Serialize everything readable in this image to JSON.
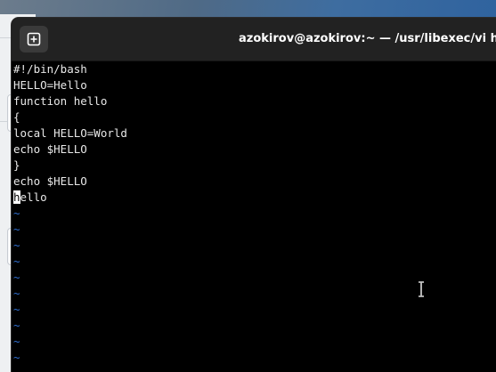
{
  "window": {
    "title": "azokirov@azokirov:~ — /usr/libexec/vi hello"
  },
  "editor": {
    "lines": [
      "#!/bin/bash",
      "HELLO=Hello",
      "function hello",
      "{",
      "local HELLO=World",
      "echo $HELLO",
      "}",
      "echo $HELLO"
    ],
    "cursor_line": {
      "cursor_char": "h",
      "rest": "ello"
    },
    "tilde": "~",
    "tilde_rows": 10
  },
  "colors": {
    "terminal_bg": "#000000",
    "text": "#e8e8e8",
    "tilde": "#2f6fd1",
    "titlebar": "#222222"
  },
  "icons": {
    "new_tab": "plus-square-icon",
    "mouse_pointer": "text-ibeam-cursor-icon"
  }
}
